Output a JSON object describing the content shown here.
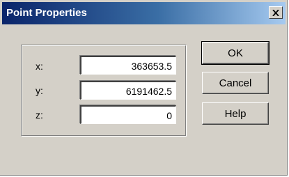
{
  "window": {
    "title": "Point Properties"
  },
  "fields": [
    {
      "label": "x:",
      "value": "363653.5"
    },
    {
      "label": "y:",
      "value": "6191462.5"
    },
    {
      "label": "z:",
      "value": "0"
    }
  ],
  "buttons": {
    "ok": "OK",
    "cancel": "Cancel",
    "help": "Help"
  },
  "icons": {
    "close": "close-icon"
  },
  "colors": {
    "titlebar_start": "#0a246a",
    "titlebar_end": "#a6caf0",
    "dialog_face": "#d4d0c8"
  }
}
